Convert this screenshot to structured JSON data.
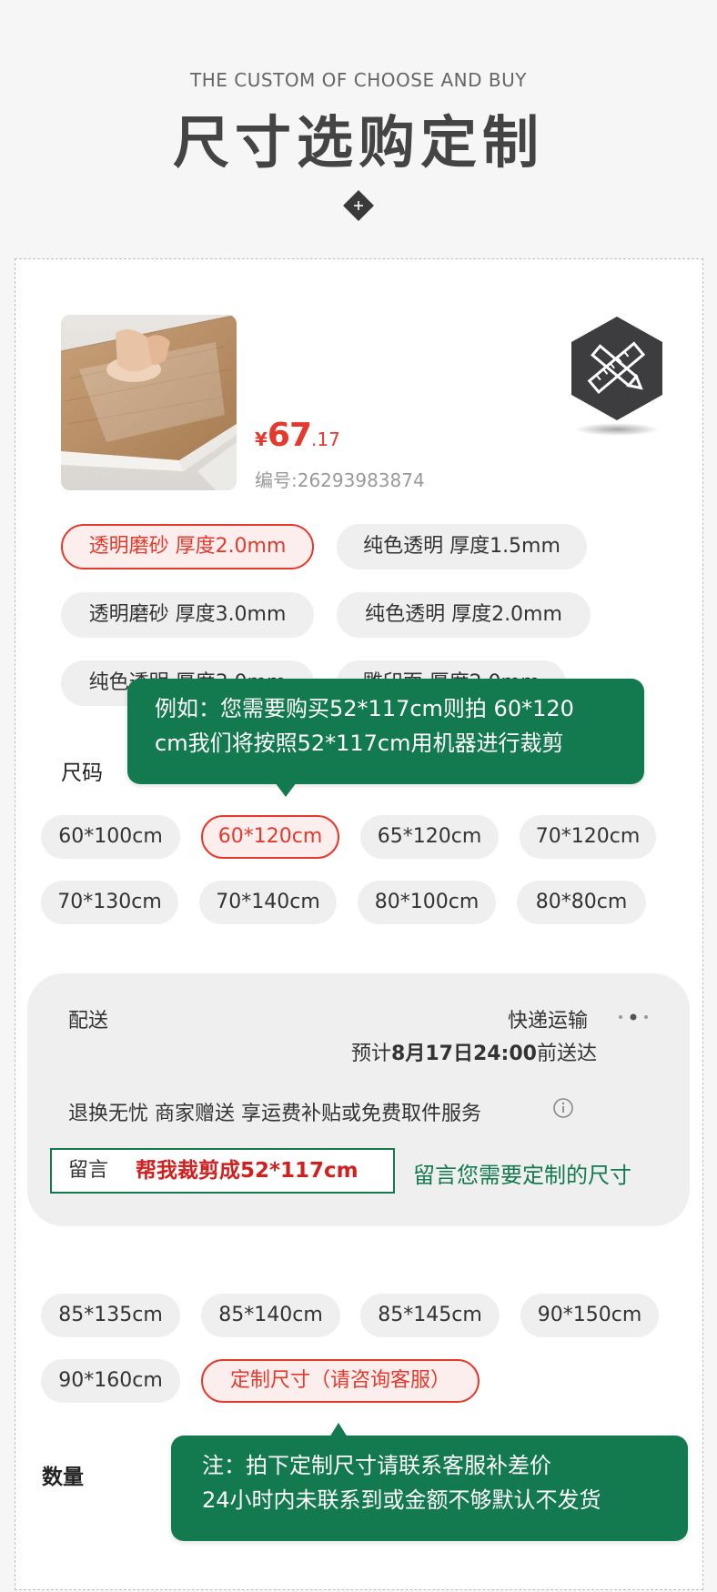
{
  "header": {
    "subtitle": "THE CUSTOM OF CHOOSE AND BUY",
    "title": "尺寸选购定制"
  },
  "product": {
    "price": {
      "currency": "¥",
      "integer": "67",
      "decimal": ".17"
    },
    "sku": "编号:26293983874"
  },
  "styles": [
    {
      "label": "透明磨砂 厚度2.0mm",
      "selected": true
    },
    {
      "label": "纯色透明 厚度1.5mm",
      "selected": false
    },
    {
      "label": "透明磨砂 厚度3.0mm",
      "selected": false
    },
    {
      "label": "纯色透明 厚度2.0mm",
      "selected": false
    },
    {
      "label": "纯色透明 厚度3.0mm",
      "selected": false
    },
    {
      "label": "雕印面 厚度2.0mm",
      "selected": false
    }
  ],
  "size_section": {
    "label": "尺码",
    "tip_lines": [
      "例如：您需要购买52*117cm则拍 60*120",
      "cm我们将按照52*117cm用机器进行裁剪"
    ]
  },
  "sizes_top": [
    {
      "label": "60*100cm",
      "selected": false
    },
    {
      "label": "60*120cm",
      "selected": true
    },
    {
      "label": "65*120cm",
      "selected": false
    },
    {
      "label": "70*120cm",
      "selected": false
    },
    {
      "label": "70*130cm",
      "selected": false
    },
    {
      "label": "70*140cm",
      "selected": false
    },
    {
      "label": "80*100cm",
      "selected": false
    },
    {
      "label": "80*80cm",
      "selected": false
    }
  ],
  "delivery": {
    "label": "配送",
    "method": "快递运输",
    "estimate_prefix": "预计",
    "estimate_date": "8月17日24:00",
    "estimate_suffix": "前送达",
    "services": "退换无忧 商家赠送 享运费补贴或免费取件服务",
    "message_label": "留言",
    "message_value": "帮我裁剪成52*117cm",
    "message_hint": "留言您需要定制的尺寸"
  },
  "sizes_bottom": [
    {
      "label": "85*135cm",
      "selected": false
    },
    {
      "label": "85*140cm",
      "selected": false
    },
    {
      "label": "85*145cm",
      "selected": false
    },
    {
      "label": "90*150cm",
      "selected": false
    },
    {
      "label": "90*160cm",
      "selected": false
    },
    {
      "label": "定制尺寸（请咨询客服）",
      "selected": true
    }
  ],
  "quantity": {
    "label": "数量",
    "tip_lines": [
      "注：拍下定制尺寸请联系客服补差价",
      "24小时内未联系到或金额不够默认不发货"
    ]
  },
  "colors": {
    "accent_red": "#e4392c",
    "accent_green": "#137a4f",
    "pill_bg": "#efefef",
    "badge_dark": "#3d3d3f"
  },
  "icons": {
    "hero_diamond": "plus-diamond-icon",
    "tool_badge": "ruler-pencil-icon",
    "menu": "more-dots-icon",
    "info": "info-icon"
  }
}
